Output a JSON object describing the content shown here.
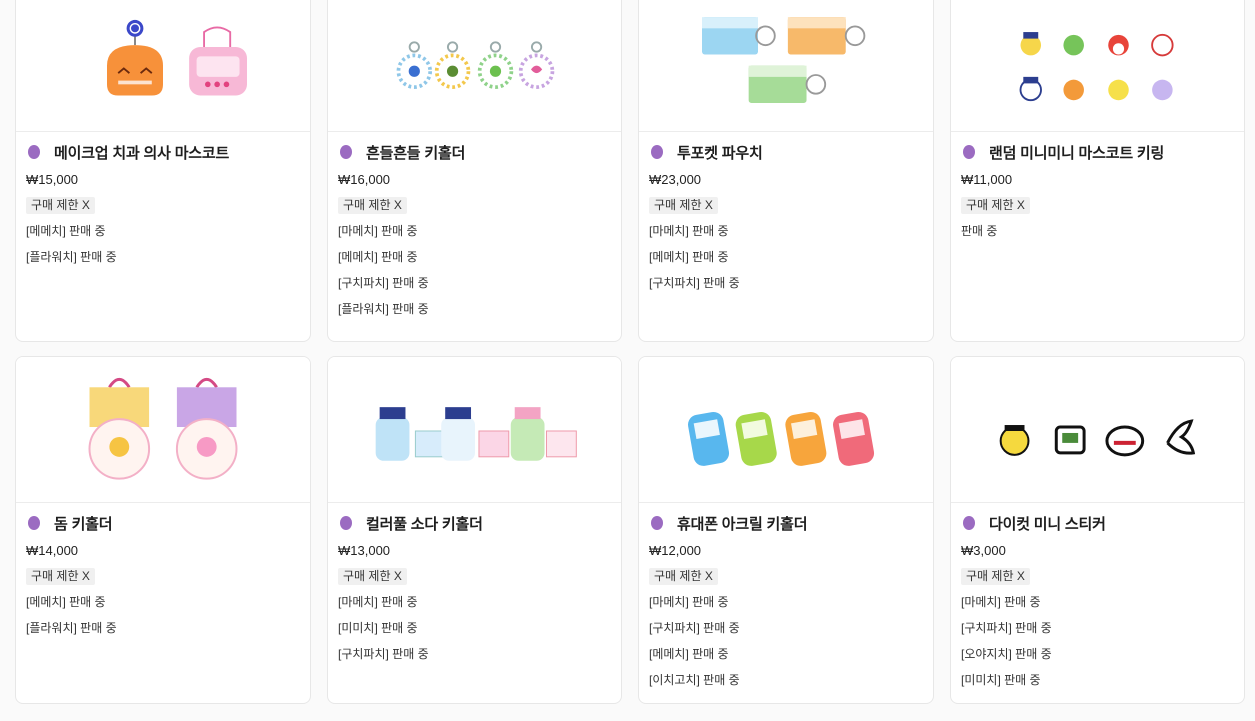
{
  "products": [
    {
      "name": "메이크업 치과 의사 마스코트",
      "price": "₩15,000",
      "limit": "구매 제한 X",
      "status": [
        "[메메치] 판매 중",
        "[플라워치] 판매 중"
      ],
      "image_icon": "makeup-mascot-image"
    },
    {
      "name": "흔들흔들 키홀더",
      "price": "₩16,000",
      "limit": "구매 제한 X",
      "status": [
        "[마메치] 판매 중",
        "[메메치] 판매 중",
        "[구치파치] 판매 중",
        "[플라워치] 판매 중"
      ],
      "image_icon": "wobble-keyholder-image"
    },
    {
      "name": "투포켓 파우치",
      "price": "₩23,000",
      "limit": "구매 제한 X",
      "status": [
        "[마메치] 판매 중",
        "[메메치] 판매 중",
        "[구치파치] 판매 중"
      ],
      "image_icon": "two-pocket-pouch-image"
    },
    {
      "name": "랜덤 미니미니 마스코트 키링",
      "price": "₩11,000",
      "limit": "구매 제한 X",
      "status": [
        "판매 중"
      ],
      "image_icon": "random-mini-mascot-image"
    },
    {
      "name": "돔 키홀더",
      "price": "₩14,000",
      "limit": "구매 제한 X",
      "status": [
        "[메메치] 판매 중",
        "[플라워치] 판매 중"
      ],
      "image_icon": "dome-keyholder-image"
    },
    {
      "name": "컬러풀 소다 키홀더",
      "price": "₩13,000",
      "limit": "구매 제한 X",
      "status": [
        "[마메치] 판매 중",
        "[미미치] 판매 중",
        "[구치파치] 판매 중"
      ],
      "image_icon": "soda-keyholder-image"
    },
    {
      "name": "휴대폰 아크릴 키홀더",
      "price": "₩12,000",
      "limit": "구매 제한 X",
      "status": [
        "[마메치] 판매 중",
        "[구치파치] 판매 중",
        "[메메치] 판매 중",
        "[이치고치] 판매 중"
      ],
      "image_icon": "phone-acrylic-keyholder-image"
    },
    {
      "name": "다이컷 미니 스티커",
      "price": "₩3,000",
      "limit": "구매 제한 X",
      "status": [
        "[마메치] 판매 중",
        "[구치파치] 판매 중",
        "[오야지치] 판매 중",
        "[미미치] 판매 중"
      ],
      "image_icon": "die-cut-sticker-image"
    }
  ],
  "colors": {
    "dot": "#9b6bc1",
    "badge_bg": "#f0f0f0",
    "border": "#e7e7e7"
  }
}
